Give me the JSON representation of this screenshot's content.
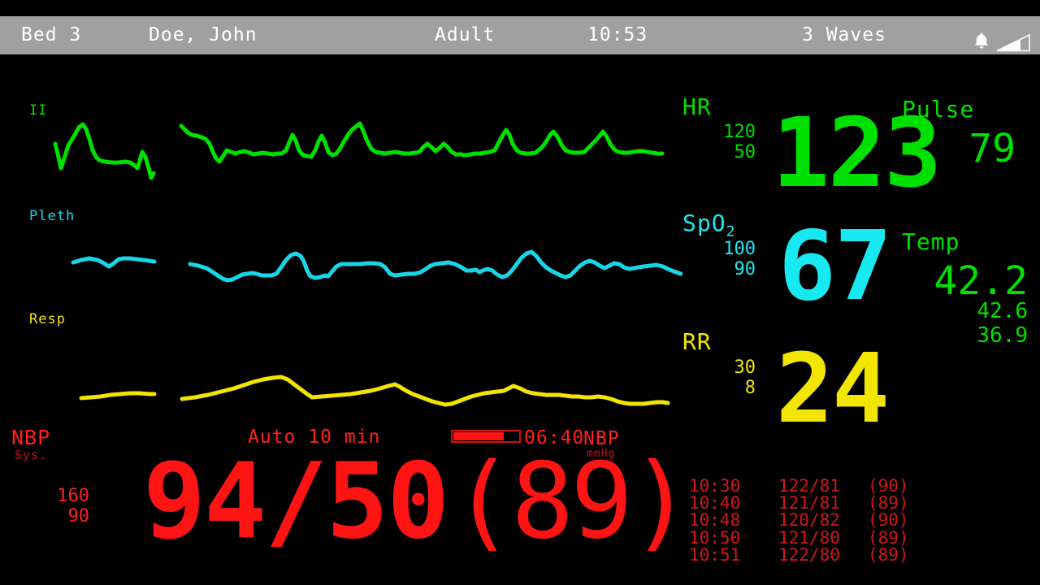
{
  "header": {
    "bed": "Bed 3",
    "patient_name": "Doe, John",
    "patient_type": "Adult",
    "time": "10:53",
    "wave_count": "3 Waves",
    "icons": [
      "bell-icon",
      "signal-wedge-icon"
    ],
    "bg_color": "#a0a0a0",
    "text_color": "#ffffff"
  },
  "waveforms": [
    {
      "label": "II",
      "color": "#00e000",
      "kind": "ecg"
    },
    {
      "label": "Pleth",
      "color": "#18d6e8",
      "kind": "pleth"
    },
    {
      "label": "Resp",
      "color": "#f2e500",
      "kind": "resp"
    }
  ],
  "vitals": {
    "hr": {
      "label": "HR",
      "limit_high": "120",
      "limit_low": "50",
      "limits": "120\n50",
      "value": "123",
      "color": "#00e000"
    },
    "pulse": {
      "label": "Pulse",
      "value": "79",
      "color": "#00e000"
    },
    "spo2": {
      "label": "SpO",
      "label_sub": "2",
      "limit_high": "100",
      "limit_low": "90",
      "limits": "100\n90",
      "value": "67",
      "color": "#18e8f0"
    },
    "temp": {
      "label": "Temp",
      "value": "42.2",
      "value2": "42.6",
      "value3": "36.9",
      "sub_values": "42.6\n36.9",
      "color": "#00e000"
    },
    "rr": {
      "label": "RR",
      "limit_high": "30",
      "limit_low": "8",
      "limits": "30\n8",
      "value": "24",
      "color": "#f2e500"
    }
  },
  "nbp": {
    "label": "NBP",
    "sub_label": "Sys.",
    "limit_high": "160",
    "limit_low": "90",
    "limits": "160\n90",
    "mode": "Auto 10 min",
    "systolic_diastolic": "94/50",
    "mean": "(89)",
    "countdown": "06:40",
    "unit_label": "NBP",
    "unit": "mmHg",
    "progress_percent": 75,
    "color": "#ff1414",
    "history": [
      {
        "time": "10:30",
        "bp": "122/81",
        "mean": "(90)"
      },
      {
        "time": "10:40",
        "bp": "121/81",
        "mean": "(89)"
      },
      {
        "time": "10:48",
        "bp": "120/82",
        "mean": "(90)"
      },
      {
        "time": "10:50",
        "bp": "121/80",
        "mean": "(89)"
      },
      {
        "time": "10:51",
        "bp": "122/80",
        "mean": "(89)"
      }
    ]
  }
}
